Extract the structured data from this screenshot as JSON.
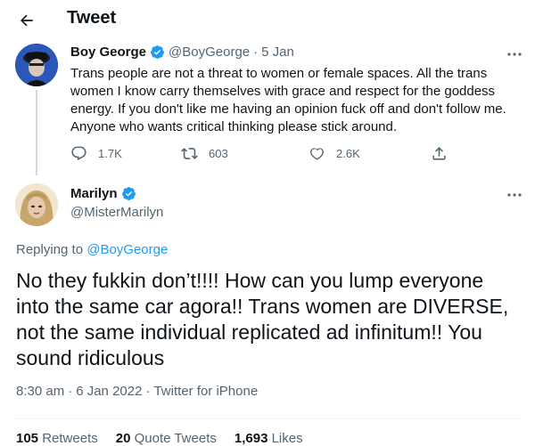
{
  "header": {
    "title": "Tweet",
    "back_icon": "arrow-left-icon"
  },
  "parent_tweet": {
    "name": "Boy George",
    "handle": "@BoyGeorge",
    "separator": "·",
    "time": "5 Jan",
    "text": "Trans people are not a threat to women or female spaces. All the trans women I know carry themselves with grace and respect for the goddess energy. If you don't like me having an opinion fuck off and don't follow me. Anyone who wants critical thinking please stick around.",
    "replies": "1.7K",
    "retweets": "603",
    "likes": "2.6K"
  },
  "main_tweet": {
    "name": "Marilyn",
    "handle": "@MisterMarilyn",
    "replying_prefix": "Replying to",
    "replying_to": "@BoyGeorge",
    "text": "No they fukkin don’t!!!! How can you lump everyone into the same car agora!! Trans women are DIVERSE, not the same individual replicated ad infinitum!! You sound ridiculous",
    "time": "8:30 am",
    "date": "6 Jan 2022",
    "source": "Twitter for iPhone",
    "dot": "·"
  },
  "stats": {
    "retweets_count": "105",
    "retweets_label": "Retweets",
    "quotes_count": "20",
    "quotes_label": "Quote Tweets",
    "likes_count": "1,693",
    "likes_label": "Likes"
  },
  "colors": {
    "accent": "#1d9bf0",
    "secondary_text": "#536471",
    "primary_text": "#0f1419"
  }
}
